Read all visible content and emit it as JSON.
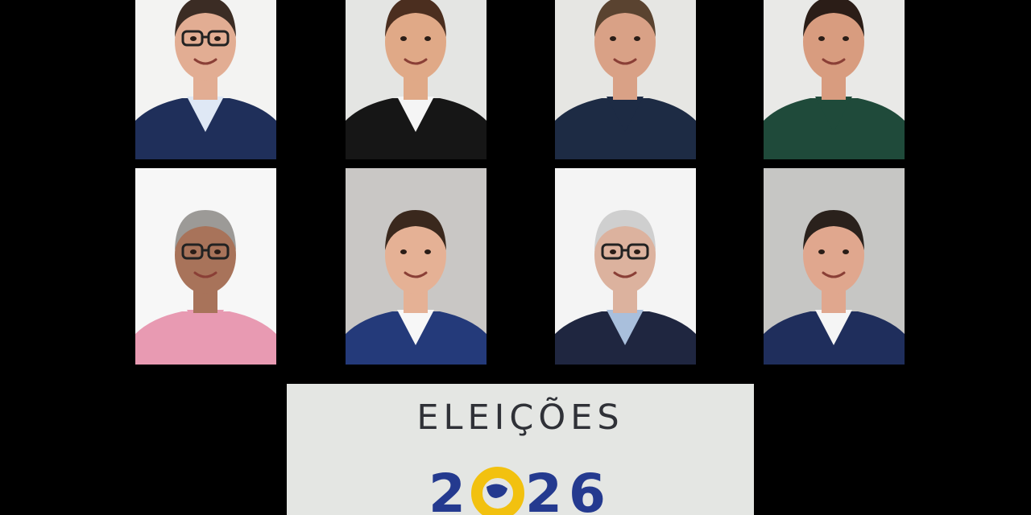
{
  "image": {
    "description_hidden": true
  },
  "portraits": [
    {
      "id": "p1",
      "bg": "#f3f3f2",
      "skin": "#e2ad93",
      "hair": "#3b2c24",
      "top": "#1f2f5a",
      "shirt": "#dfe8f5",
      "glasses": true
    },
    {
      "id": "p2",
      "bg": "#e4e5e3",
      "skin": "#e0a987",
      "hair": "#4b2e1f",
      "top": "#161616",
      "shirt": "#f5f5f5",
      "glasses": false
    },
    {
      "id": "p3",
      "bg": "#e6e6e3",
      "skin": "#d9a186",
      "hair": "#5a4330",
      "top": "#1d2b44",
      "shirt": "#1d2b44",
      "glasses": false
    },
    {
      "id": "p4",
      "bg": "#e9e9e7",
      "skin": "#d89c7f",
      "hair": "#2b1d17",
      "top": "#1f4a3a",
      "shirt": "#1f4a3a",
      "glasses": false
    },
    {
      "id": "p5",
      "bg": "#f7f7f7",
      "skin": "#a8735a",
      "hair": "#9c9a97",
      "top": "#e89ab2",
      "shirt": "#e89ab2",
      "glasses": true
    },
    {
      "id": "p6",
      "bg": "#c9c7c5",
      "skin": "#e5b195",
      "hair": "#3a281d",
      "top": "#243a7a",
      "shirt": "#f7f7f7",
      "glasses": false
    },
    {
      "id": "p7",
      "bg": "#f4f4f4",
      "skin": "#dcb29e",
      "hair": "#cfcfcf",
      "top": "#1f2640",
      "shirt": "#a9bfdc",
      "glasses": true
    },
    {
      "id": "p8",
      "bg": "#c6c6c4",
      "skin": "#e0a78e",
      "hair": "#2a211c",
      "top": "#1f2e5c",
      "shirt": "#f5f5f5",
      "glasses": false
    }
  ],
  "banner": {
    "title": "ELEIÇÕES",
    "year_digits": [
      "2",
      "0",
      "2",
      "6"
    ],
    "colors": {
      "background": "#e4e6e3",
      "title": "#2f3137",
      "digits": "#243a8f",
      "zero": "#f2c10f"
    }
  }
}
